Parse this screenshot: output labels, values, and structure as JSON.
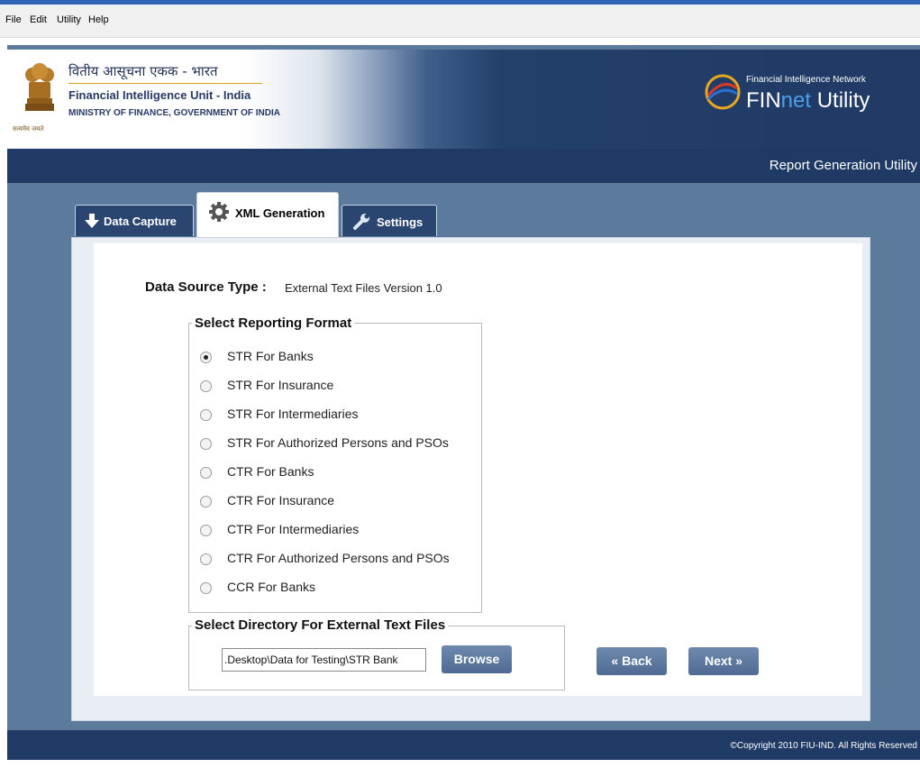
{
  "menu": [
    {
      "label": "File"
    },
    {
      "label": "Edit"
    },
    {
      "label": "Utility"
    },
    {
      "label": "Help"
    }
  ],
  "header": {
    "hindi_title": "वितीय आसूचना एकक - भारत",
    "org_name": "Financial Intelligence Unit - India",
    "ministry": "MINISTRY OF FINANCE, GOVERNMENT OF INDIA",
    "emblem_motto": "सत्यमेव जयते",
    "network_label": "Financial Intelligence Network",
    "product_prefix": "FIN",
    "product_net": "net",
    "product_suffix": " Utility"
  },
  "subheader": {
    "title": "Report Generation Utility"
  },
  "tabs": [
    {
      "label": "Data Capture",
      "icon": "arrow-down-icon",
      "active": false
    },
    {
      "label": "XML Generation",
      "icon": "gear-icon",
      "active": true
    },
    {
      "label": "Settings",
      "icon": "wrench-icon",
      "active": false
    }
  ],
  "data_source": {
    "label": "Data Source Type :",
    "value": "External Text Files Version 1.0"
  },
  "reporting_format": {
    "legend": "Select Reporting Format",
    "options": [
      {
        "label": "STR For Banks",
        "selected": true
      },
      {
        "label": "STR For Insurance",
        "selected": false
      },
      {
        "label": "STR For Intermediaries",
        "selected": false
      },
      {
        "label": "STR For Authorized Persons and PSOs",
        "selected": false
      },
      {
        "label": "CTR For Banks",
        "selected": false
      },
      {
        "label": "CTR For Insurance",
        "selected": false
      },
      {
        "label": "CTR For Intermediaries",
        "selected": false
      },
      {
        "label": "CTR For Authorized Persons and PSOs",
        "selected": false
      },
      {
        "label": "CCR For Banks",
        "selected": false
      }
    ]
  },
  "directory": {
    "legend": "Select Directory For External Text Files",
    "value": ".Desktop\\Data for Testing\\STR Bank",
    "browse_label": "Browse"
  },
  "nav": {
    "back_label": "« Back",
    "next_label": "Next »"
  },
  "footer": {
    "copyright": "©Copyright 2010 FIU-IND. All Rights Reserved"
  },
  "colors": {
    "dark_navy": "#1f3a64",
    "frame_blue": "#5c7a9c",
    "button_blue": "#5b7aa3"
  }
}
